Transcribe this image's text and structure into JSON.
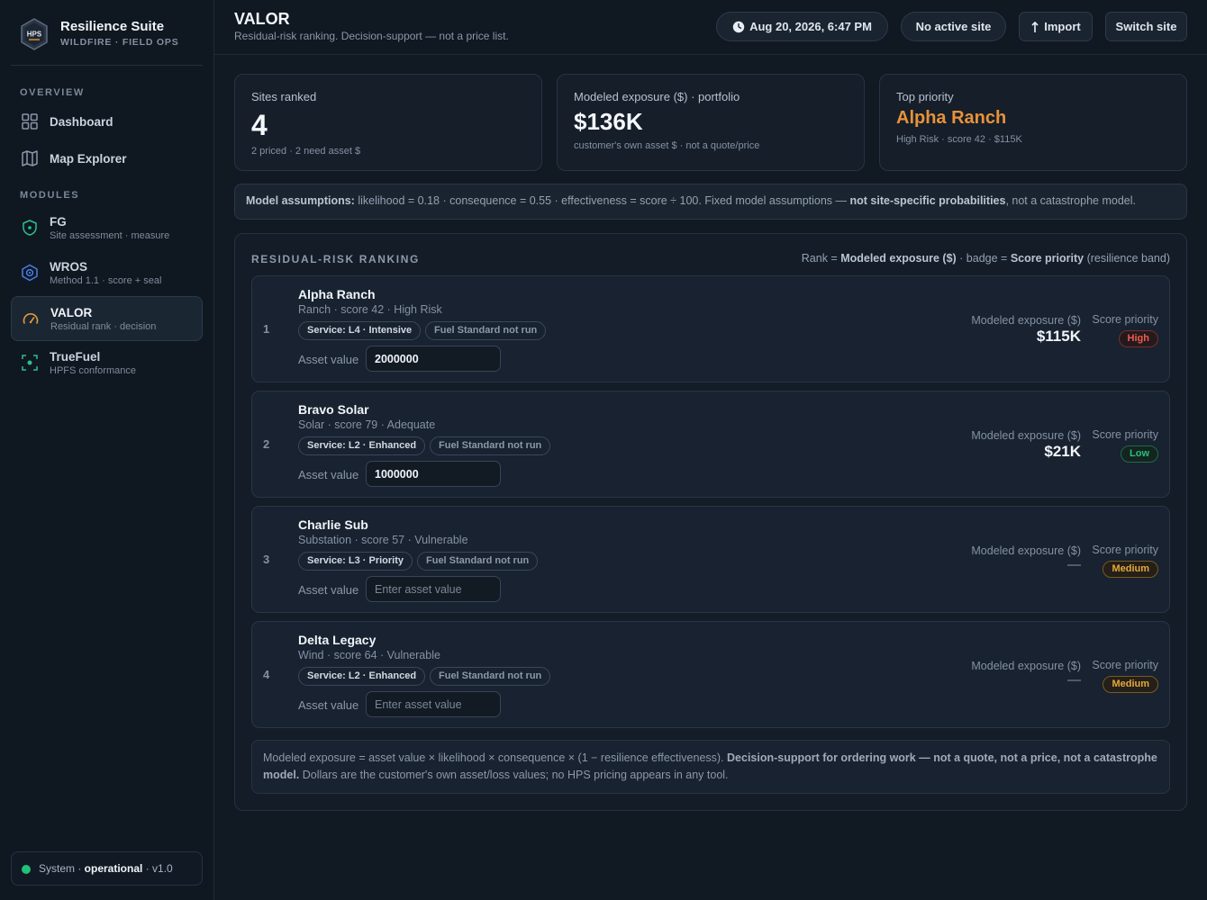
{
  "brand": {
    "logo_text": "HPS",
    "title": "Resilience Suite",
    "subtitle": "WILDFIRE · FIELD OPS"
  },
  "sidebar": {
    "overview_label": "OVERVIEW",
    "overview_items": [
      {
        "label": "Dashboard",
        "icon": "dashboard-grid-icon"
      },
      {
        "label": "Map Explorer",
        "icon": "map-icon"
      }
    ],
    "modules_label": "MODULES",
    "modules": [
      {
        "label": "FG",
        "sub": "Site assessment · measure",
        "icon": "shield-icon",
        "color": "#2fbf8c"
      },
      {
        "label": "WROS",
        "sub": "Method 1.1 · score + seal",
        "icon": "target-icon",
        "color": "#4a7ee8"
      },
      {
        "label": "VALOR",
        "sub": "Residual rank · decision",
        "icon": "gauge-icon",
        "color": "#e69a3a",
        "active": true
      },
      {
        "label": "TrueFuel",
        "sub": "HPFS conformance",
        "icon": "scan-icon",
        "color": "#2fbf8c"
      }
    ],
    "status": {
      "prefix": "System · ",
      "state": "operational",
      "version": " · v1.0",
      "color": "#22c07a"
    }
  },
  "header": {
    "title": "VALOR",
    "subtitle": "Residual-risk ranking. Decision-support — not a price list.",
    "datetime": "Aug 20, 2026, 6:47 PM",
    "site_status": "No active site",
    "import_label": "Import",
    "switch_label": "Switch site"
  },
  "stats": {
    "sites": {
      "label": "Sites ranked",
      "value": "4",
      "note": "2 priced · 2 need asset $"
    },
    "exposure": {
      "label": "Modeled exposure ($) · portfolio",
      "value": "$136K",
      "note": "customer's own asset $ · not a quote/price"
    },
    "top": {
      "label": "Top priority",
      "value": "Alpha Ranch",
      "note": "High Risk · score 42 · $115K",
      "color": "#e8923a"
    }
  },
  "assumptions": {
    "lead": "Model assumptions:",
    "body": " likelihood = 0.18 · consequence = 0.55 · effectiveness = score ÷ 100. Fixed model assumptions — ",
    "emph": "not site-specific probabilities",
    "tail": ", not a catastrophe model."
  },
  "ranking": {
    "title": "RESIDUAL-RISK RANKING",
    "legend_a": "Rank = ",
    "legend_b": "Modeled exposure ($)",
    "legend_c": " · badge = ",
    "legend_d": "Score priority",
    "legend_e": " (resilience band)",
    "exposure_label": "Modeled exposure ($)",
    "priority_label": "Score priority",
    "asset_label": "Asset value",
    "asset_placeholder": "Enter asset value",
    "sites": [
      {
        "rank": "1",
        "name": "Alpha Ranch",
        "meta": "Ranch · score 42 · High Risk",
        "service": "Service: L4 · Intensive",
        "fuel": "Fuel Standard not run",
        "asset": "2000000",
        "exposure": "$115K",
        "priority": "High"
      },
      {
        "rank": "2",
        "name": "Bravo Solar",
        "meta": "Solar · score 79 · Adequate",
        "service": "Service: L2 · Enhanced",
        "fuel": "Fuel Standard not run",
        "asset": "1000000",
        "exposure": "$21K",
        "priority": "Low"
      },
      {
        "rank": "3",
        "name": "Charlie Sub",
        "meta": "Substation · score 57 · Vulnerable",
        "service": "Service: L3 · Priority",
        "fuel": "Fuel Standard not run",
        "asset": "",
        "exposure": "—",
        "priority": "Medium"
      },
      {
        "rank": "4",
        "name": "Delta Legacy",
        "meta": "Wind · score 64 · Vulnerable",
        "service": "Service: L2 · Enhanced",
        "fuel": "Fuel Standard not run",
        "asset": "",
        "exposure": "—",
        "priority": "Medium"
      }
    ]
  },
  "footnote": {
    "a": "Modeled exposure = asset value × likelihood × consequence × (1 − resilience effectiveness). ",
    "b": "Decision-support for ordering work — not a quote, not a price, not a catastrophe model.",
    "c": " Dollars are the customer's own asset/loss values; no HPS pricing appears in any tool."
  }
}
